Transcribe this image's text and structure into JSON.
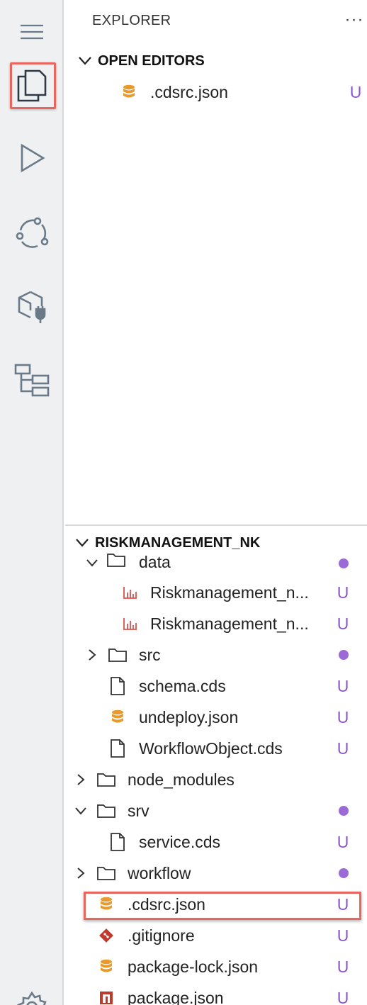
{
  "sidebar": {
    "title": "EXPLORER",
    "more": "···"
  },
  "open_editors": {
    "label": "OPEN EDITORS",
    "files": [
      {
        "name": ".cdsrc.json",
        "status": "U",
        "icon": "database-icon"
      }
    ]
  },
  "project": {
    "label": "RISKMANAGEMENT_NK",
    "items": [
      {
        "name": "data",
        "type": "folder",
        "expanded": true,
        "status": "dot"
      },
      {
        "name": "Riskmanagement_n...",
        "type": "csv",
        "status": "U"
      },
      {
        "name": "Riskmanagement_n...",
        "type": "csv",
        "status": "U"
      },
      {
        "name": "src",
        "type": "folder",
        "expanded": false,
        "status": "dot"
      },
      {
        "name": "schema.cds",
        "type": "file",
        "status": "U"
      },
      {
        "name": "undeploy.json",
        "type": "json",
        "status": "U"
      },
      {
        "name": "WorkflowObject.cds",
        "type": "file",
        "status": "U"
      },
      {
        "name": "node_modules",
        "type": "folder",
        "expanded": false,
        "status": ""
      },
      {
        "name": "srv",
        "type": "folder",
        "expanded": true,
        "status": "dot"
      },
      {
        "name": "service.cds",
        "type": "file",
        "status": "U"
      },
      {
        "name": "workflow",
        "type": "folder",
        "expanded": false,
        "status": "dot"
      },
      {
        "name": ".cdsrc.json",
        "type": "json",
        "status": "U"
      },
      {
        "name": ".gitignore",
        "type": "git",
        "status": "U"
      },
      {
        "name": "package-lock.json",
        "type": "json",
        "status": "U"
      },
      {
        "name": "package.json",
        "type": "npm",
        "status": "U"
      }
    ]
  },
  "colors": {
    "status_purple": "#8b57c9",
    "highlight_red": "#e8665e",
    "json_orange": "#e99a2c",
    "csv_red": "#d9534f",
    "git_red": "#c0392b"
  }
}
